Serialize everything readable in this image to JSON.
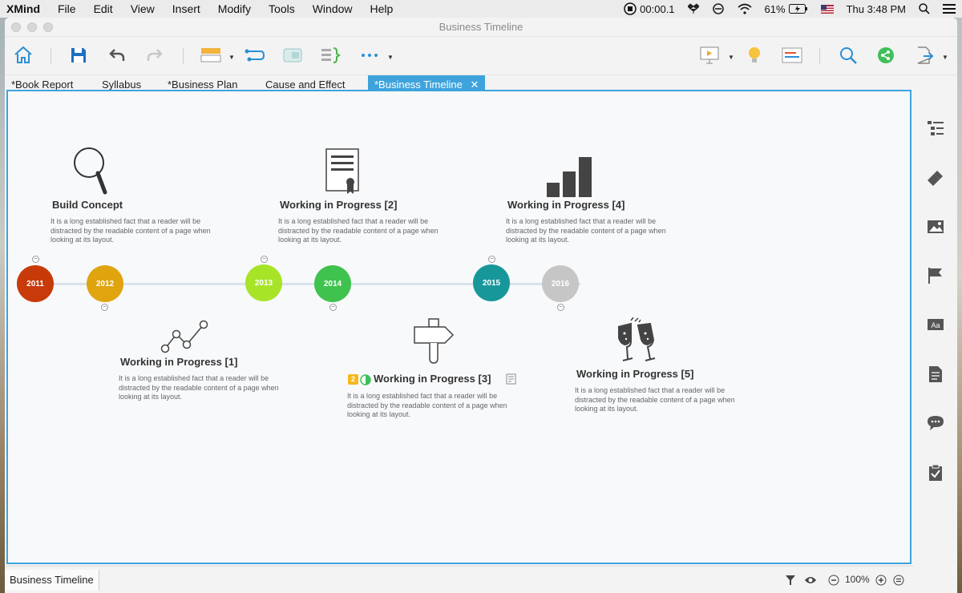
{
  "menubar": {
    "app": "XMind",
    "items": [
      "File",
      "Edit",
      "View",
      "Insert",
      "Modify",
      "Tools",
      "Window",
      "Help"
    ],
    "record_time": "00:00.1",
    "battery": "61%",
    "clock": "Thu 3:48 PM"
  },
  "window": {
    "title": "Business Timeline"
  },
  "toolbar": {
    "icons": [
      "home-icon",
      "save-icon",
      "undo-icon",
      "redo-icon",
      "topic-icon",
      "relationship-icon",
      "boundary-icon",
      "summary-icon",
      "more-icon",
      "presentation-icon",
      "brainstorm-icon",
      "gantt-icon",
      "search-icon",
      "share-icon",
      "export-icon"
    ]
  },
  "tabs": [
    {
      "label": "*Book Report"
    },
    {
      "label": "Syllabus"
    },
    {
      "label": "*Business Plan"
    },
    {
      "label": "Cause and Effect"
    },
    {
      "label": "*Business Timeline",
      "close": "✕"
    }
  ],
  "timeline": {
    "colors": {
      "accent": "#3ea3dc",
      "line": "#d9e1ea"
    },
    "years": [
      {
        "label": "2011",
        "color": "#c83a0a"
      },
      {
        "label": "2012",
        "color": "#e0a40e"
      },
      {
        "label": "2013",
        "color": "#a7e428"
      },
      {
        "label": "2014",
        "color": "#3fc24e"
      },
      {
        "label": "2015",
        "color": "#17979a"
      },
      {
        "label": "2016",
        "color": "#c6c6c6"
      }
    ],
    "topics": [
      {
        "title": "Build Concept",
        "icon": "magnifier-icon",
        "desc": "It is a long established fact that a reader will be distracted by the readable content of a page when looking at its layout."
      },
      {
        "title": "Working in Progress [1]",
        "icon": "line-chart-icon",
        "desc": "It is a long established fact that a reader will be distracted by the readable content of a page when looking at its layout."
      },
      {
        "title": "Working in Progress [2]",
        "icon": "certificate-icon",
        "desc": "It is a long established fact that a reader will be distracted by the readable content of a page when looking at its layout."
      },
      {
        "title": "Working in Progress [3]",
        "icon": "signpost-icon",
        "priority": "2",
        "desc": "It is a long established fact that a reader will be distracted by the readable content of a page when looking at its layout."
      },
      {
        "title": "Working in Progress [4]",
        "icon": "bar-chart-icon",
        "desc": "It is a long established fact that a reader will be distracted by the readable content of a page when looking at its layout."
      },
      {
        "title": "Working in Progress [5]",
        "icon": "champagne-icon",
        "desc": "It is a long established fact that a reader will be distracted by the readable content of a page when looking at its layout."
      }
    ]
  },
  "sidebar": {
    "icons": [
      "outline-icon",
      "format-icon",
      "image-icon",
      "marker-icon",
      "text-style-icon",
      "notes-icon",
      "comments-icon",
      "task-icon"
    ]
  },
  "statusbar": {
    "sheet": "Business Timeline",
    "zoom": "100%"
  }
}
